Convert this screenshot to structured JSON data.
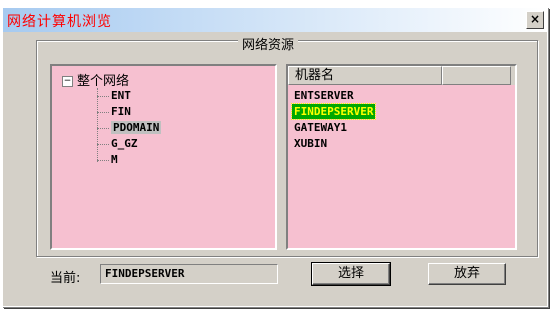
{
  "window": {
    "title": "网络计算机浏览",
    "close_label": "×"
  },
  "group": {
    "title": "网络资源"
  },
  "tree": {
    "root_label": "整个网络",
    "root_toggle": "−",
    "items": [
      {
        "label": "ENT"
      },
      {
        "label": "FIN"
      },
      {
        "label": "PDOMAIN",
        "selected": true
      },
      {
        "label": "G_GZ"
      },
      {
        "label": "M"
      }
    ]
  },
  "list": {
    "header": "机器名",
    "items": [
      {
        "label": "ENTSERVER"
      },
      {
        "label": "FINDEPSERVER",
        "selected": true
      },
      {
        "label": "GATEWAY1"
      },
      {
        "label": "XUBIN"
      }
    ]
  },
  "current": {
    "label": "当前:",
    "value": "FINDEPSERVER"
  },
  "buttons": {
    "select_label": "选择",
    "cancel_label": "放弃"
  },
  "colors": {
    "title_text": "#ff0000",
    "panel_bg": "#f6c0d0",
    "selection_bg": "#00a800",
    "selection_text": "#ffff00"
  }
}
